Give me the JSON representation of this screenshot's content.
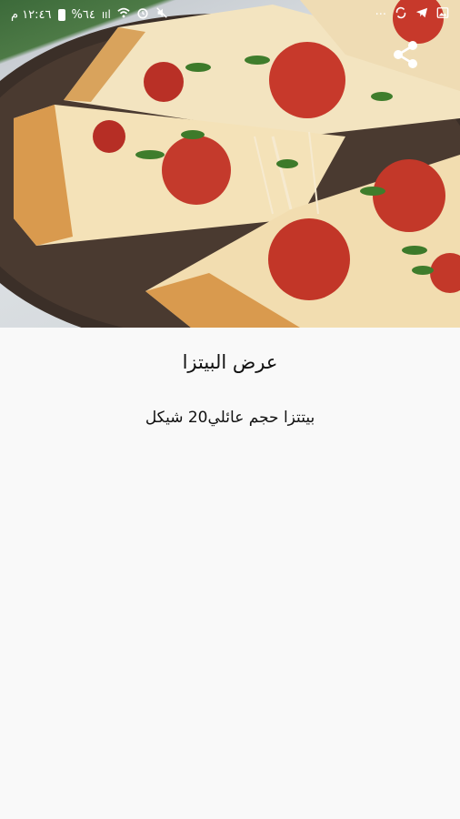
{
  "status_bar": {
    "time": "١٢:٤٦ م",
    "battery": "%٦٤",
    "more": "···",
    "icons": [
      "mute-icon",
      "alarm-icon",
      "wifi-icon",
      "signal-icon",
      "battery-icon",
      "sync-icon",
      "telegram-icon",
      "gallery-icon"
    ]
  },
  "hero": {
    "image": "pizza-photo",
    "share_icon": "share-icon"
  },
  "offer": {
    "title": "عرض البيتزا",
    "description": "بيتتزا حجم عائلي20 شيكل"
  }
}
